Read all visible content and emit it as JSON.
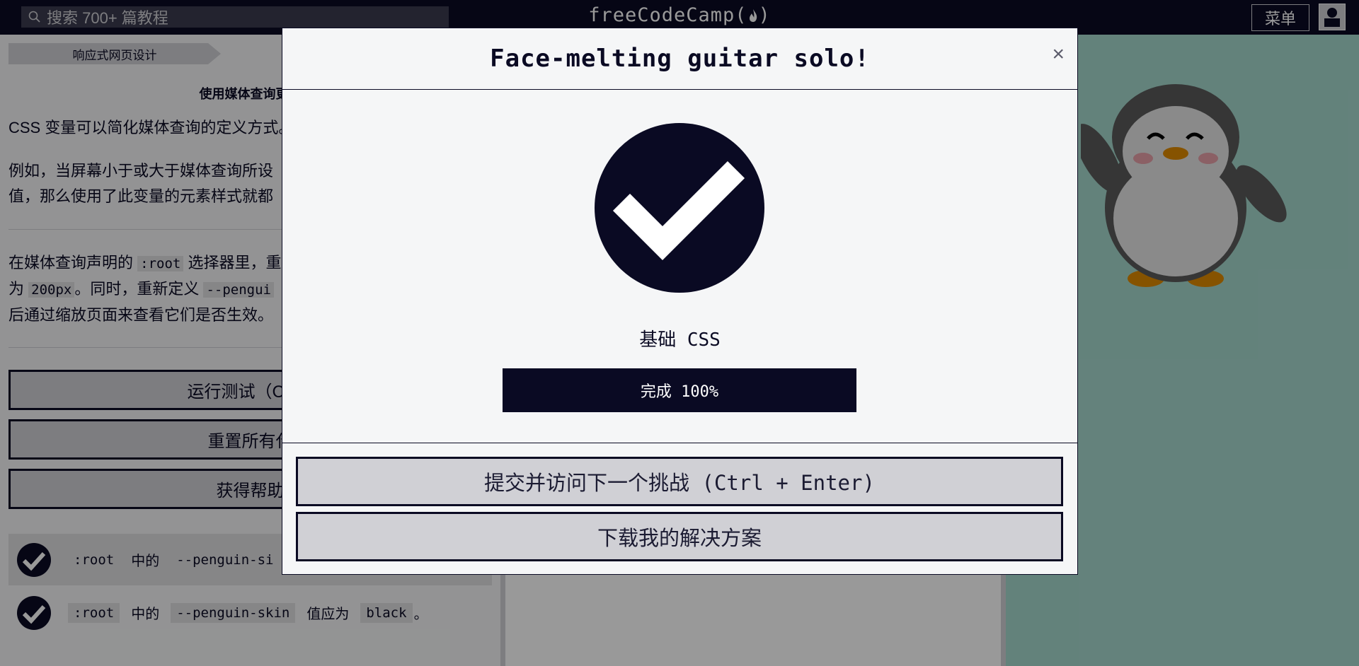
{
  "nav": {
    "search_placeholder": "搜索 700+ 篇教程",
    "logo_text": "freeCodeCamp",
    "menu_label": "菜单"
  },
  "left": {
    "breadcrumb": "响应式网页设计",
    "challenge_title": "使用媒体查询更改",
    "para1": "CSS 变量可以简化媒体查询的定义方式。",
    "para2": "例如，当屏幕小于或大于媒体查询所设",
    "para2b": "值，那么使用了此变量的元素样式就都",
    "para3_a": "在媒体查询声明的",
    "para3_code1": ":root",
    "para3_b": "选择器里，重",
    "para3_c": "为",
    "para3_code2": "200px",
    "para3_d": "。同时，重新定义",
    "para3_code3": "--pengui",
    "para3_e": "后通过缩放页面来查看它们是否生效。",
    "run_tests": "运行测试（Ctrl +",
    "reset": "重置所有代",
    "help": "获得帮助",
    "tests": [
      {
        "code1": ":root",
        "mid": "中的",
        "code2": "--penguin-si",
        "tail": "",
        "code3": ""
      },
      {
        "code1": ":root",
        "mid": "中的",
        "code2": "--penguin-skin",
        "tail": "值应为",
        "code3": "black",
        "end": "。"
      }
    ]
  },
  "modal": {
    "title": "Face-melting guitar solo!",
    "close": "×",
    "certification": "基础 CSS",
    "progress_label": "完成 100%",
    "progress_value": 100,
    "submit_label": "提交并访问下一个挑战 (Ctrl + Enter)",
    "download_label": "下载我的解决方案"
  },
  "colors": {
    "primary": "#0a0a23",
    "button_bg": "#d0d0d5",
    "preview_bg": "#a6d9ce"
  }
}
